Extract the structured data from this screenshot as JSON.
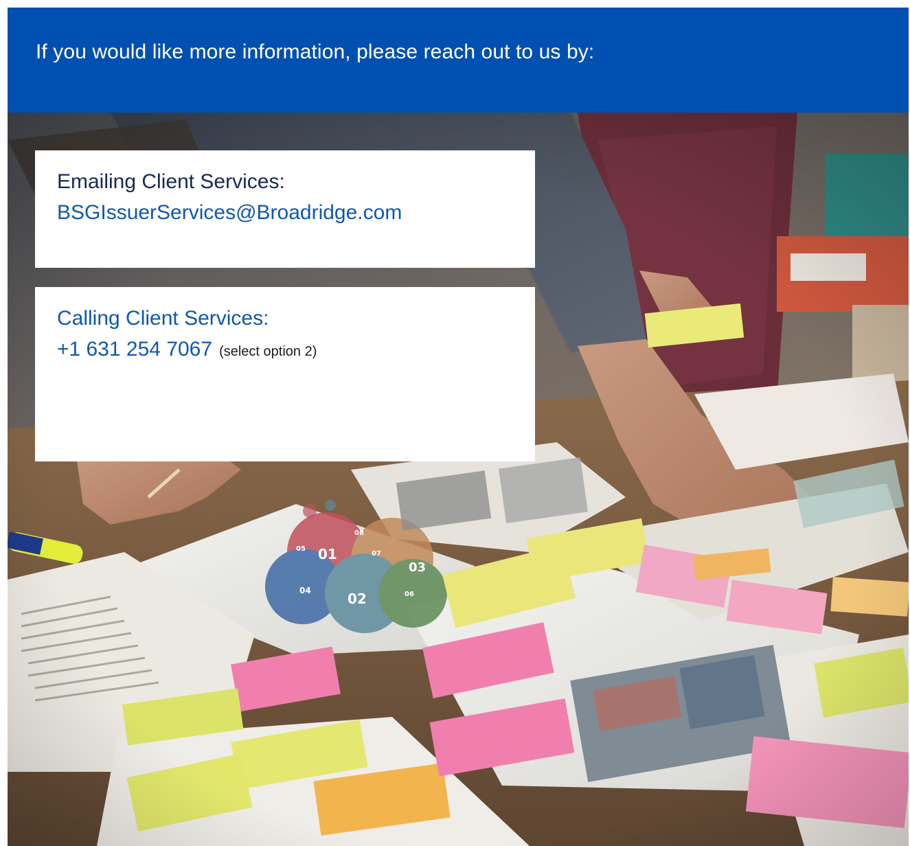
{
  "banner": {
    "text": "If you would like more information, please reach out to us by:"
  },
  "email_card": {
    "heading": "Emailing Client Services:",
    "address": "BSGIssuerServices@Broadridge.com"
  },
  "phone_card": {
    "heading": "Calling Client Services:",
    "number": "+1 631 254 7067",
    "note": "(select option 2)"
  },
  "colors": {
    "banner_blue": "#0050b1",
    "link_blue": "#0f58ad",
    "heading_navy": "#152a4f"
  },
  "photo": {
    "icon": "office-planning-photo",
    "diagram_numbers": [
      "01",
      "02",
      "03",
      "04",
      "05",
      "06",
      "07",
      "08"
    ]
  }
}
